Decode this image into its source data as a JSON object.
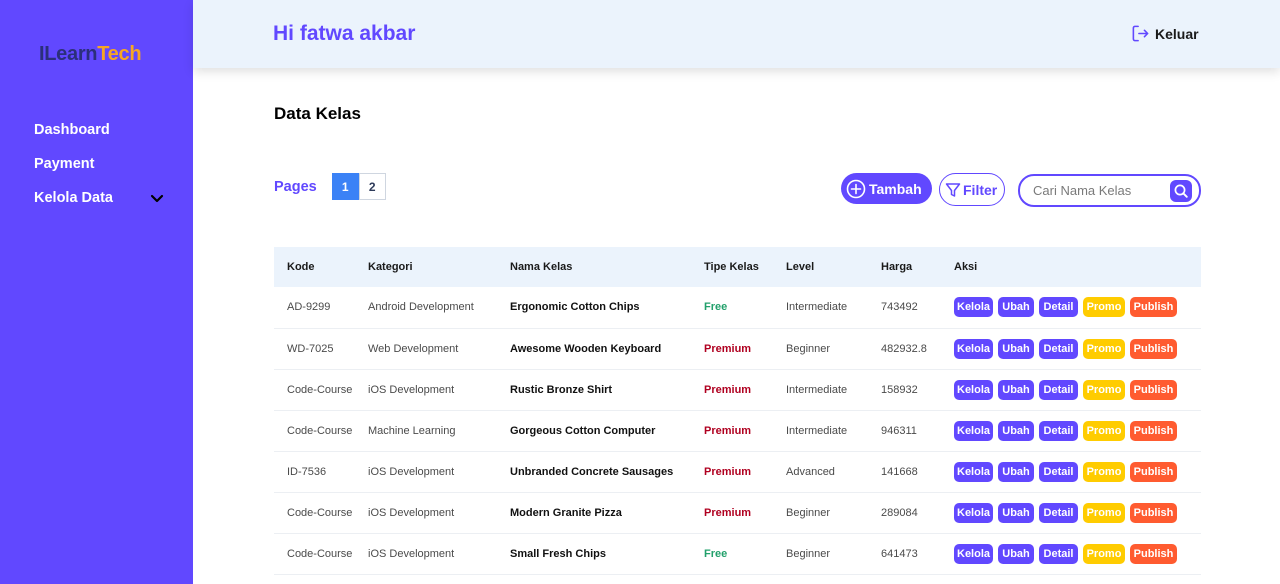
{
  "colors": {
    "primary": "#6148FF",
    "free": "#22a06b",
    "premium": "#b00020",
    "promo": "#FFCC00",
    "publish": "#FF5B30",
    "header_bg": "#EBF3FC"
  },
  "sidebar": {
    "logo_part1": "ILearn",
    "logo_part2": "Tech",
    "items": [
      {
        "label": "Dashboard"
      },
      {
        "label": "Payment"
      },
      {
        "label": "Kelola Data",
        "icon": "chevron-down-icon"
      }
    ]
  },
  "header": {
    "greeting": "Hi fatwa akbar",
    "logout_label": "Keluar"
  },
  "main": {
    "title": "Data Kelas",
    "pager": {
      "label": "Pages",
      "pages": [
        "1",
        "2"
      ],
      "current": "1"
    },
    "add_label": "Tambah",
    "filter_label": "Filter",
    "search_placeholder": "Cari Nama Kelas"
  },
  "table": {
    "headers": [
      "Kode",
      "Kategori",
      "Nama Kelas",
      "Tipe Kelas",
      "Level",
      "Harga",
      "Aksi"
    ],
    "action_labels": {
      "kelola": "Kelola",
      "ubah": "Ubah",
      "detail": "Detail",
      "promo": "Promo",
      "publish": "Publish"
    },
    "rows": [
      {
        "kode": "AD-9299",
        "kategori": "Android Development",
        "nama": "Ergonomic Cotton Chips",
        "tipe": "Free",
        "level": "Intermediate",
        "harga": "743492"
      },
      {
        "kode": "WD-7025",
        "kategori": "Web Development",
        "nama": "Awesome Wooden Keyboard",
        "tipe": "Premium",
        "level": "Beginner",
        "harga": "482932.8"
      },
      {
        "kode": "Code-Course",
        "kategori": "iOS Development",
        "nama": "Rustic Bronze Shirt",
        "tipe": "Premium",
        "level": "Intermediate",
        "harga": "158932"
      },
      {
        "kode": "Code-Course",
        "kategori": "Machine Learning",
        "nama": "Gorgeous Cotton Computer",
        "tipe": "Premium",
        "level": "Intermediate",
        "harga": "946311"
      },
      {
        "kode": "ID-7536",
        "kategori": "iOS Development",
        "nama": "Unbranded Concrete Sausages",
        "tipe": "Premium",
        "level": "Advanced",
        "harga": "141668"
      },
      {
        "kode": "Code-Course",
        "kategori": "iOS Development",
        "nama": "Modern Granite Pizza",
        "tipe": "Premium",
        "level": "Beginner",
        "harga": "289084"
      },
      {
        "kode": "Code-Course",
        "kategori": "iOS Development",
        "nama": "Small Fresh Chips",
        "tipe": "Free",
        "level": "Beginner",
        "harga": "641473"
      }
    ]
  }
}
